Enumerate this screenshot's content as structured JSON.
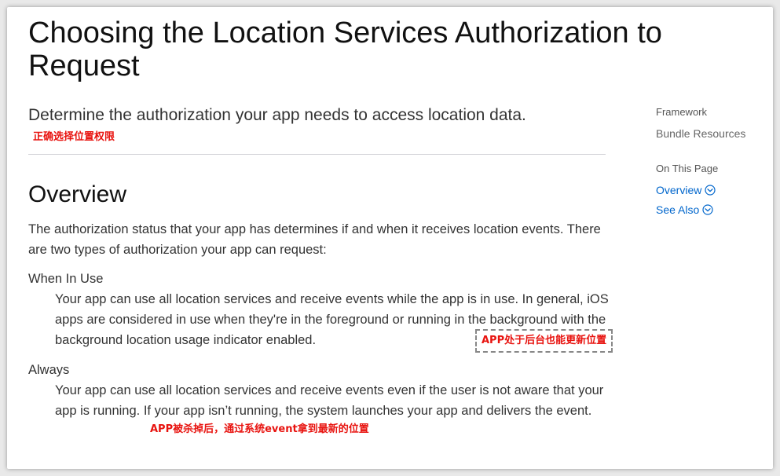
{
  "title": "Choosing the Location Services Authorization to Request",
  "abstract": "Determine the authorization your app needs to access location data.",
  "annotations": {
    "abstract_note": "正确选择位置权限",
    "when_in_use_note": "APP处于后台也能更新位置",
    "always_note": "APP被杀掉后，通过系统event拿到最新的位置"
  },
  "overview": {
    "heading": "Overview",
    "paragraph": "The authorization status that your app has determines if and when it receives location events. There are two types of authorization your app can request:",
    "terms": [
      {
        "term": "When In Use",
        "definition": "Your app can use all location services and receive events while the app is in use. In general, iOS apps are considered in use when they're in the foreground or running in the background with the background location usage indicator enabled."
      },
      {
        "term": "Always",
        "definition": "Your app can use all location services and receive events even if the user is not aware that your app is running. If your app isn’t running, the system launches your app and delivers the event."
      }
    ]
  },
  "sidebar": {
    "framework_label": "Framework",
    "framework_value": "Bundle Resources",
    "on_this_page_label": "On This Page",
    "links": [
      {
        "label": "Overview",
        "icon": "chevron-circle-down-icon"
      },
      {
        "label": "See Also",
        "icon": "chevron-circle-down-icon"
      }
    ]
  },
  "colors": {
    "link": "#0066cc",
    "annotation": "#e8130f"
  }
}
